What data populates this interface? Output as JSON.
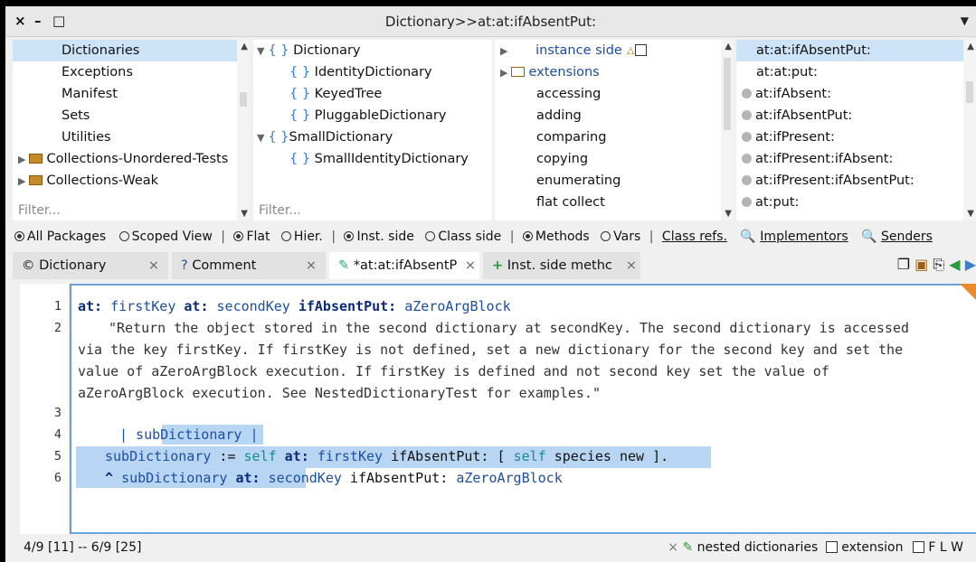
{
  "window": {
    "title": "Dictionary>>at:at:ifAbsentPut:",
    "close_glyph": "×",
    "minimize_glyph": "–",
    "maximize_glyph": "□",
    "menu_glyph": "▼"
  },
  "packages": {
    "items": [
      "Dictionaries",
      "Exceptions",
      "Manifest",
      "Sets",
      "Utilities",
      "Collections-Unordered-Tests",
      "Collections-Weak"
    ],
    "selected": "Dictionaries",
    "filter_placeholder": "Filter..."
  },
  "classes": {
    "items": [
      "Dictionary",
      "IdentityDictionary",
      "KeyedTree",
      "PluggableDictionary",
      "SmallDictionary",
      "SmallIdentityDictionary"
    ],
    "filter_placeholder": "Filter..."
  },
  "protocols": {
    "items": [
      "instance side",
      "extensions",
      "accessing",
      "adding",
      "comparing",
      "copying",
      "enumerating",
      "flat collect"
    ]
  },
  "methods": {
    "items": [
      "at:at:ifAbsentPut:",
      "at:at:put:",
      "at:ifAbsent:",
      "at:ifAbsentPut:",
      "at:ifPresent:",
      "at:ifPresent:ifAbsent:",
      "at:ifPresent:ifAbsentPut:",
      "at:put:"
    ],
    "selected": "at:at:ifAbsentPut:"
  },
  "options": {
    "all_packages": "All Packages",
    "scoped_view": "Scoped View",
    "flat": "Flat",
    "hier": "Hier.",
    "inst_side": "Inst. side",
    "class_side": "Class side",
    "methods": "Methods",
    "vars": "Vars",
    "class_refs": "Class refs.",
    "implementors": "Implementors",
    "senders": "Senders"
  },
  "tabs": [
    {
      "label": "Dictionary",
      "prefix": "©"
    },
    {
      "label": "Comment",
      "prefix": "?"
    },
    {
      "label": "*at:at:ifAbsentP",
      "prefix": ""
    },
    {
      "label": "Inst. side methc",
      "prefix": "+"
    }
  ],
  "editor": {
    "line_numbers": [
      "1",
      "2",
      "3",
      "4",
      "5",
      "6"
    ],
    "sig_kw1": "at:",
    "sig_arg1": "firstKey",
    "sig_kw2": "at:",
    "sig_arg2": "secondKey",
    "sig_kw3": "ifAbsentPut:",
    "sig_arg3": "aZeroArgBlock",
    "comment_l1": "\"Return the object stored in the second dictionary at secondKey. The second dictionary is accessed",
    "comment_l2": "via the key firstKey. If firstKey is not defined, set a new dictionary for the second key and set the",
    "comment_l3": "value of aZeroArgBlock execution. If firstKey is defined and not second key set the value of",
    "comment_l4": "aZeroArgBlock execution. See NestedDictionaryTest for examples.\"",
    "temps": "| subDictionary |",
    "l5_var": "subDictionary",
    "l5_assign": " := ",
    "l5_self": "self",
    "l5_kw1": " at: ",
    "l5_arg": "firstKey",
    "l5_kw2": " ifAbsentPut: ",
    "l5_rest1": "[ ",
    "l5_self2": "self",
    "l5_rest2": " species new ].",
    "l6_caret": "^ ",
    "l6_var": "subDictionary",
    "l6_kw1": " at: ",
    "l6_arg1": "secondKey",
    "l6_kw2": " ifAbsentPut: ",
    "l6_arg2": "aZeroArgBlock"
  },
  "status": {
    "position": "4/9 [11] -- 6/9 [25]",
    "close_glyph": "×",
    "protocol": "nested dictionaries",
    "extension": "extension",
    "flags": "F  L  W"
  }
}
